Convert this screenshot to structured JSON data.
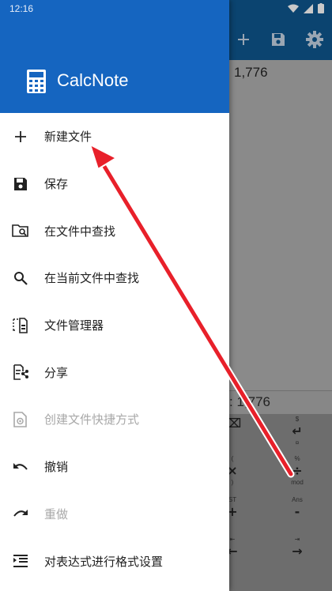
{
  "status_bar": {
    "time": "12:16"
  },
  "drawer": {
    "app_name": "CalcNote",
    "items": [
      {
        "label": "新建文件",
        "icon": "plus-icon",
        "enabled": true
      },
      {
        "label": "保存",
        "icon": "save-icon",
        "enabled": true
      },
      {
        "label": "在文件中查找",
        "icon": "folder-search-icon",
        "enabled": true
      },
      {
        "label": "在当前文件中查找",
        "icon": "search-icon",
        "enabled": true
      },
      {
        "label": "文件管理器",
        "icon": "file-manager-icon",
        "enabled": true
      },
      {
        "label": "分享",
        "icon": "share-icon",
        "enabled": true
      },
      {
        "label": "创建文件快捷方式",
        "icon": "shortcut-icon",
        "enabled": false
      },
      {
        "label": "撤销",
        "icon": "undo-icon",
        "enabled": true
      },
      {
        "label": "重做",
        "icon": "redo-icon",
        "enabled": false
      },
      {
        "label": "对表达式进行格式设置",
        "icon": "format-indent-icon",
        "enabled": true
      }
    ]
  },
  "background": {
    "editor_value": "1,776",
    "result_text": ": 1,776",
    "keys": [
      {
        "sup": "",
        "main": "⌫",
        "sub": ""
      },
      {
        "sup": "$",
        "main": "↵",
        "sub": "¤"
      },
      {
        "sup": "(",
        "main": "×",
        "sub": ")"
      },
      {
        "sup": "%",
        "main": "÷",
        "sub": "mod"
      },
      {
        "sup": "ST",
        "main": "+",
        "sub": ""
      },
      {
        "sup": "Ans",
        "main": "-",
        "sub": ""
      },
      {
        "sup": "⇤",
        "main": "←",
        "sub": ""
      },
      {
        "sup": "⇥",
        "main": "→",
        "sub": ""
      }
    ]
  },
  "colors": {
    "drawer_header": "#1565c0",
    "annotation_arrow": "#e8202a"
  }
}
